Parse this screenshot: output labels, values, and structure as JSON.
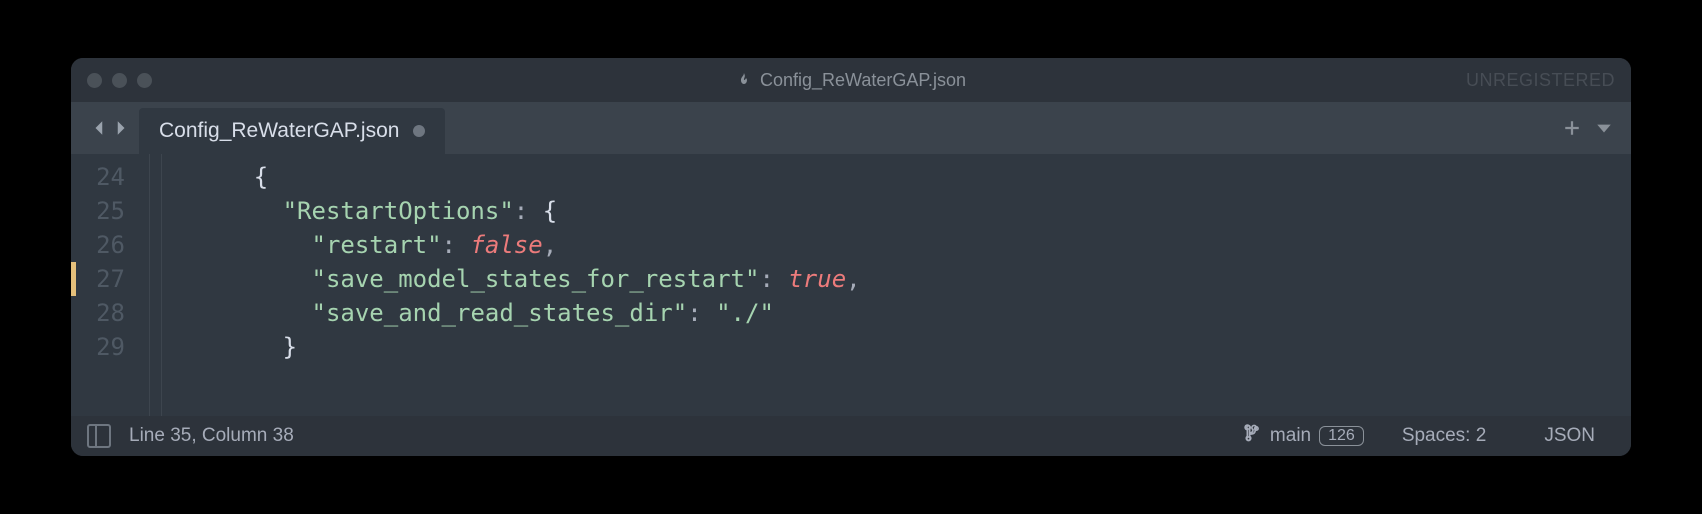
{
  "titlebar": {
    "title": "Config_ReWaterGAP.json",
    "registration": "UNREGISTERED"
  },
  "tab": {
    "label": "Config_ReWaterGAP.json"
  },
  "gutter": {
    "lines": [
      "24",
      "25",
      "26",
      "27",
      "28",
      "29"
    ]
  },
  "code": {
    "line24": {
      "indent": "      ",
      "brace": "{"
    },
    "line25": {
      "indent": "        ",
      "key": "\"RestartOptions\"",
      "colon": ": ",
      "brace": "{"
    },
    "line26": {
      "indent": "          ",
      "key": "\"restart\"",
      "colon": ": ",
      "value": "false",
      "comma": ","
    },
    "line27": {
      "indent": "          ",
      "key": "\"save_model_states_for_restart\"",
      "colon": ": ",
      "value": "true",
      "comma": ","
    },
    "line28": {
      "indent": "          ",
      "key": "\"save_and_read_states_dir\"",
      "colon": ": ",
      "value": "\"./\""
    },
    "line29": {
      "indent": "        ",
      "brace": "}"
    }
  },
  "statusbar": {
    "position": "Line 35, Column 38",
    "branch": "main",
    "branch_count": "126",
    "indent": "Spaces: 2",
    "syntax": "JSON"
  }
}
